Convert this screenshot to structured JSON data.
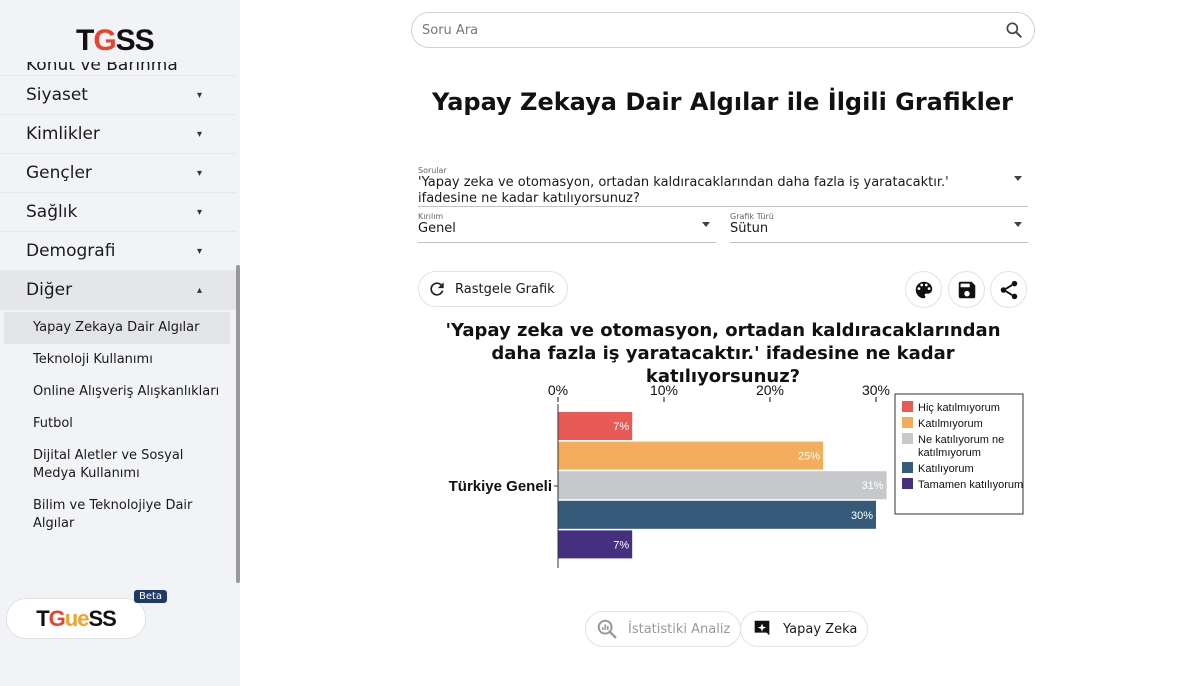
{
  "sidebar": {
    "logo": {
      "prefix": "T",
      "accent": "G",
      "rest": "SS"
    },
    "menu": [
      {
        "label": "Konut ve Barınma",
        "cut": true
      },
      {
        "label": "Siyaset",
        "caret": "▾"
      },
      {
        "label": "Kimlikler",
        "caret": "▾"
      },
      {
        "label": "Gençler",
        "caret": "▾"
      },
      {
        "label": "Sağlık",
        "caret": "▾"
      },
      {
        "label": "Demografi",
        "caret": "▾"
      },
      {
        "label": "Diğer",
        "caret": "▴"
      }
    ],
    "submenu": [
      {
        "label": "Yapay Zekaya Dair Algılar"
      },
      {
        "label": "Teknoloji Kullanımı"
      },
      {
        "label": "Online Alışveriş Alışkanlıkları"
      },
      {
        "label": "Futbol"
      },
      {
        "label": "Dijital Aletler ve Sosyal Medya Kullanımı"
      },
      {
        "label": "Bilim ve Teknolojiye Dair Algılar"
      }
    ],
    "tguess": {
      "a": "T",
      "b": "G",
      "c": "ue",
      "d": "SS"
    },
    "beta": "Beta"
  },
  "search": {
    "placeholder": "Soru Ara"
  },
  "page_title": "Yapay Zekaya Dair Algılar ile İlgili Grafikler",
  "filters": {
    "question_label": "Sorular",
    "question_value": "'Yapay zeka ve otomasyon, ortadan kaldıracaklarından daha fazla iş yaratacaktır.' ifadesine ne kadar katılıyorsunuz?",
    "breakdown_label": "Kırılım",
    "breakdown_value": "Genel",
    "chart_type_label": "Grafik Türü",
    "chart_type_value": "Sütun"
  },
  "actions": {
    "random_label": "Rastgele Grafik"
  },
  "chart_title": "'Yapay zeka ve otomasyon, ortadan kaldıracaklarından daha fazla iş yaratacaktır.' ifadesine ne kadar katılıyorsunuz?",
  "chart_data": {
    "type": "bar",
    "orientation": "horizontal",
    "categories": [
      "Türkiye Geneli"
    ],
    "xlim": [
      0,
      30
    ],
    "xticks": [
      0,
      10,
      20,
      30
    ],
    "tick_suffix": "%",
    "series": [
      {
        "name": "Hiç katılmıyorum",
        "values": [
          7
        ],
        "color": "#e85a56"
      },
      {
        "name": "Katılmıyorum",
        "values": [
          25
        ],
        "color": "#f3ad5c"
      },
      {
        "name": "Ne katılıyorum ne katılmıyorum",
        "values": [
          31
        ],
        "color": "#c6c8cc"
      },
      {
        "name": "Katılıyorum",
        "values": [
          30
        ],
        "color": "#355a7a"
      },
      {
        "name": "Tamamen katılıyorum",
        "values": [
          7
        ],
        "color": "#45307f"
      }
    ],
    "legend_position": "right"
  },
  "bottom": {
    "analysis_label": "İstatistiki Analiz",
    "ai_label": "Yapay Zeka"
  }
}
